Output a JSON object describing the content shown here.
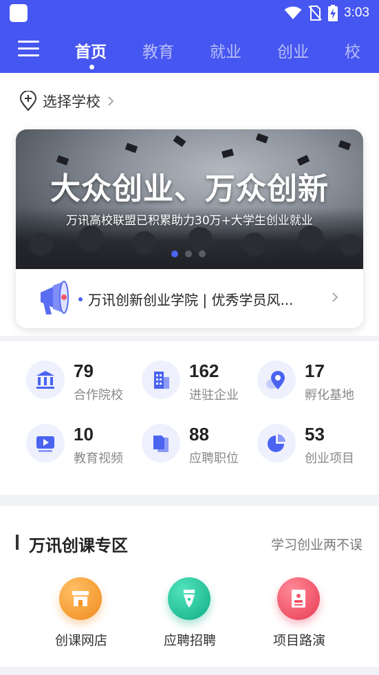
{
  "status_bar": {
    "time": "3:03"
  },
  "nav": {
    "tabs": [
      {
        "label": "首页",
        "active": true
      },
      {
        "label": "教育",
        "active": false
      },
      {
        "label": "就业",
        "active": false
      },
      {
        "label": "创业",
        "active": false
      },
      {
        "label": "校",
        "active": false
      }
    ]
  },
  "school_selector": {
    "label": "选择学校"
  },
  "banner": {
    "title": "大众创业、万众创新",
    "subtitle": "万讯高校联盟已积累助力30万+大学生创业就业",
    "slide_count": 3,
    "active_slide": 1
  },
  "notice": {
    "text": "万讯创新创业学院 | 优秀学员风..."
  },
  "stats": [
    {
      "value": "79",
      "label": "合作院校",
      "icon": "bank-icon"
    },
    {
      "value": "162",
      "label": "进驻企业",
      "icon": "building-icon"
    },
    {
      "value": "17",
      "label": "孵化基地",
      "icon": "location-pin-icon"
    },
    {
      "value": "10",
      "label": "教育视频",
      "icon": "video-icon"
    },
    {
      "value": "88",
      "label": "应聘职位",
      "icon": "document-icon"
    },
    {
      "value": "53",
      "label": "创业项目",
      "icon": "pie-chart-icon"
    }
  ],
  "course_zone": {
    "title": "万讯创课专区",
    "subtitle": "学习创业两不误",
    "items": [
      {
        "label": "创课网店",
        "icon": "shop-icon",
        "color": "#f79a2e"
      },
      {
        "label": "应聘招聘",
        "icon": "pen-icon",
        "color": "#18c29a"
      },
      {
        "label": "项目路演",
        "icon": "presentation-icon",
        "color": "#f0566b"
      }
    ]
  },
  "colors": {
    "primary": "#4656f0",
    "accent": "#4a63f0"
  }
}
